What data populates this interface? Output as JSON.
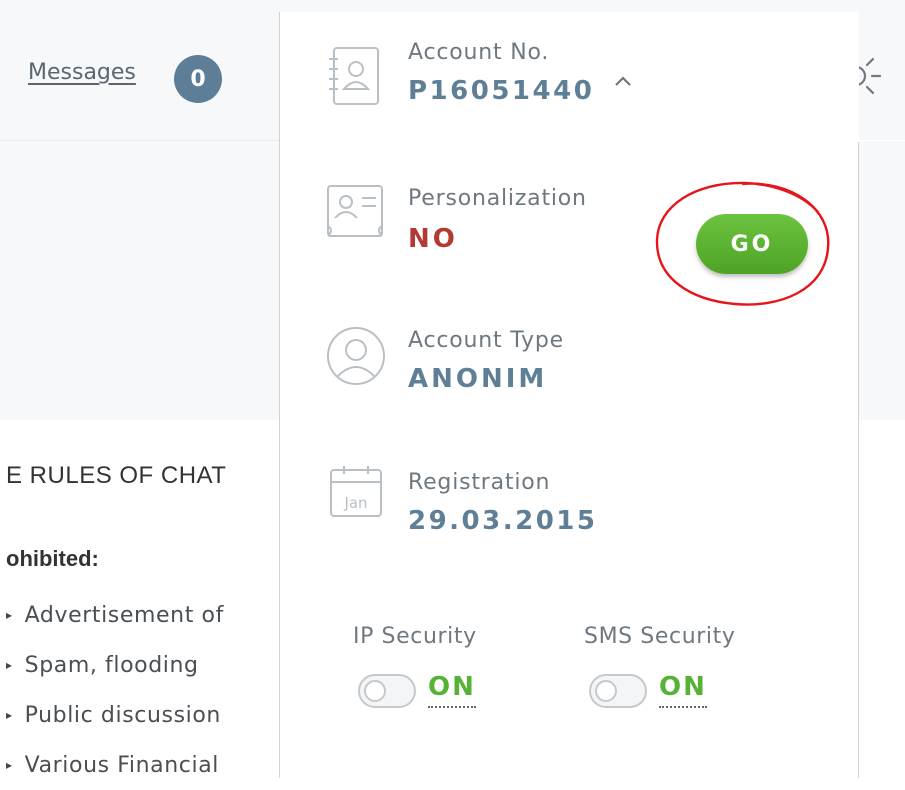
{
  "header": {
    "messages_label": "Messages",
    "messages_count": "0"
  },
  "account": {
    "account_no_label": "Account No.",
    "account_no_value": "P16051440",
    "personalization_label": "Personalization",
    "personalization_value": "NO",
    "go_label": "GO",
    "account_type_label": "Account Type",
    "account_type_value": "ANONIM",
    "registration_label": "Registration",
    "registration_value": "29.03.2015",
    "calendar_month": "Jan",
    "ip_security_label": "IP Security",
    "ip_security_value": "ON",
    "sms_security_label": "SMS Security",
    "sms_security_value": "ON"
  },
  "chat_rules": {
    "title": "E RULES OF CHAT",
    "prohibited": "ohibited:",
    "items": [
      "Advertisement of",
      "Spam, flooding",
      "Public discussion",
      "Various Financial"
    ]
  },
  "colors": {
    "accent_blue": "#5f7f97",
    "warning_red": "#b23a32",
    "success_green": "#55b236",
    "annotation_red": "#e8141b"
  },
  "icons": {
    "account": "address-book-icon",
    "personalization": "id-card-icon",
    "account_type": "user-avatar-icon",
    "registration": "calendar-icon",
    "language": "us-flag-icon",
    "theme": "sun-icon",
    "expand": "chevron-up-icon"
  }
}
